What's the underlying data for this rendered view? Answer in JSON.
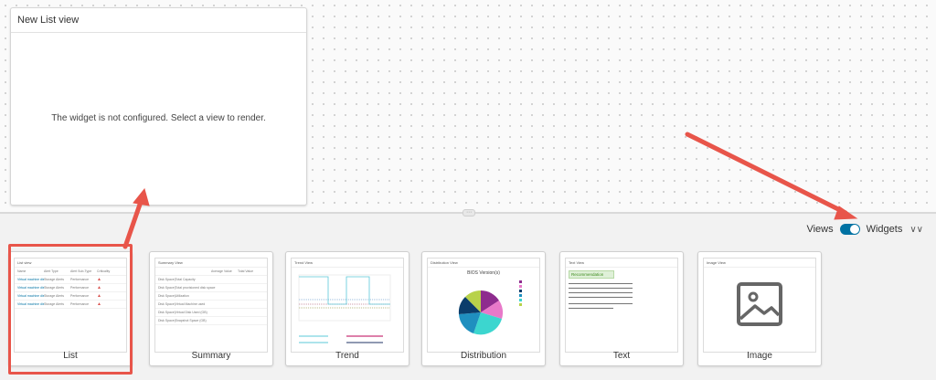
{
  "widget": {
    "title": "New List view",
    "message": "The widget is not configured. Select a view to render."
  },
  "toggle": {
    "left_label": "Views",
    "right_label": "Widgets",
    "state": "Widgets"
  },
  "cards": [
    {
      "label": "List",
      "thumb_title": "List view",
      "selected": true
    },
    {
      "label": "Summary",
      "thumb_title": "Summary View"
    },
    {
      "label": "Trend",
      "thumb_title": "Trend View"
    },
    {
      "label": "Distribution",
      "thumb_title": "Distribution View",
      "chart_title": "BIOS Version(s)"
    },
    {
      "label": "Text",
      "thumb_title": "Text View",
      "recommendation": "Recommendation"
    },
    {
      "label": "Image",
      "thumb_title": "Image View"
    }
  ],
  "list_thumb": {
    "headers": [
      "Name",
      "Alert Type",
      "Alert Sub-Type",
      "Criticality"
    ],
    "rows": [
      [
        "Virtual machine disk...",
        "Storage Alerts",
        "Performance"
      ],
      [
        "Virtual machine disk...",
        "Storage Alerts",
        "Performance"
      ],
      [
        "Virtual machine disk...",
        "Storage Alerts",
        "Performance"
      ],
      [
        "Virtual machine disk...",
        "Storage Alerts",
        "Performance"
      ]
    ]
  },
  "summary_thumb": {
    "headers": [
      "",
      "Average Value",
      "Total Value"
    ],
    "rows": [
      "Disk Space|Total Capacity",
      "Disk Space|Total provisioned disk space",
      "Disk Space|Utilization",
      "Disk Space|Virtual Machine used",
      "Disk Space|Virtual Disk Used (GB)",
      "Disk Space|Snapshot Space (GB)"
    ]
  },
  "colors": {
    "accent": "#0072a3",
    "annotation": "#e8554a"
  }
}
